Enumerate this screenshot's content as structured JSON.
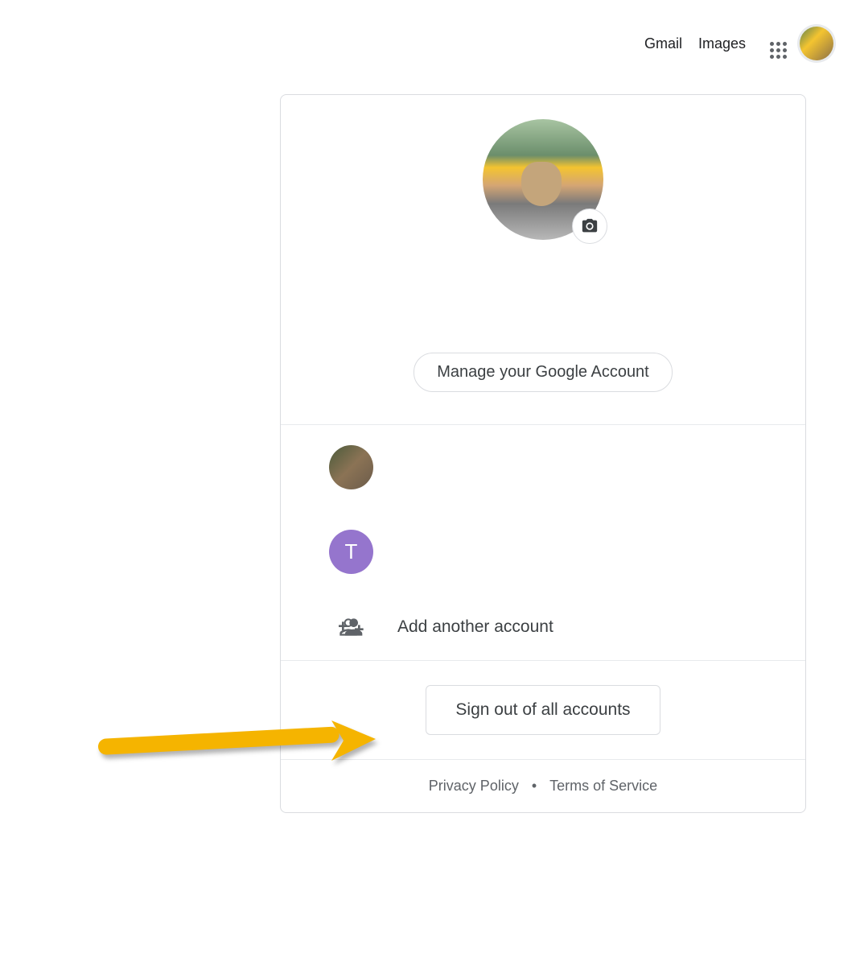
{
  "header": {
    "gmail_label": "Gmail",
    "images_label": "Images"
  },
  "account_card": {
    "manage_label": "Manage your Google Account",
    "accounts": [
      {
        "type": "photo"
      },
      {
        "type": "letter",
        "initial": "T",
        "bg": "#9575cd"
      }
    ],
    "add_account_label": "Add another account",
    "signout_label": "Sign out of all accounts"
  },
  "footer": {
    "privacy_label": "Privacy Policy",
    "terms_label": "Terms of Service"
  },
  "annotation": {
    "arrow_color": "#f5b400"
  }
}
